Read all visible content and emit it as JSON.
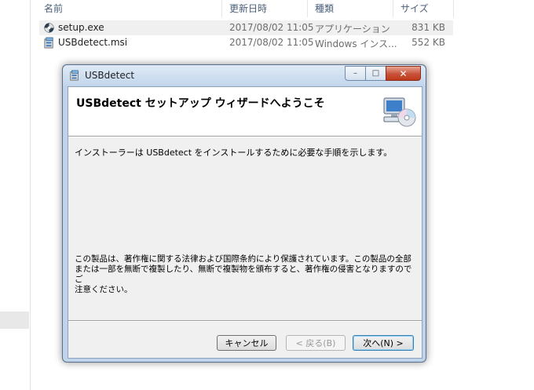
{
  "explorer": {
    "columns": {
      "name": "名前",
      "date_modified": "更新日時",
      "type": "種類",
      "size": "サイズ"
    },
    "files": [
      {
        "name": "setup.exe",
        "date": "2017/08/02 11:05",
        "type": "アプリケーション",
        "size": "831 KB",
        "icon": "setup-exe-icon"
      },
      {
        "name": "USBdetect.msi",
        "date": "2017/08/02 11:05",
        "type": "Windows インス...",
        "size": "552 KB",
        "icon": "msi-package-icon"
      }
    ]
  },
  "window": {
    "title": "USBdetect",
    "caption_buttons": {
      "minimize": "–",
      "maximize": "□",
      "close": "✕"
    },
    "banner_title": "USBdetect セットアップ ウィザードへようこそ",
    "intro": "インストーラーは USBdetect をインストールするために必要な手順を示します。",
    "copyright": "この製品は、著作権に関する法律および国際条約により保護されています。この製品の全部\nまたは一部を無断で複製したり、無断で複製物を頒布すると、著作権の侵害となりますのでご\n注意ください。",
    "buttons": {
      "cancel": "キャンセル",
      "back": "< 戻る(B)",
      "next": "次へ(N) >"
    }
  },
  "colors": {
    "close_button": "#c7533b",
    "window_frame": "#bfd4ea",
    "dialog_face": "#f0f0f0"
  }
}
